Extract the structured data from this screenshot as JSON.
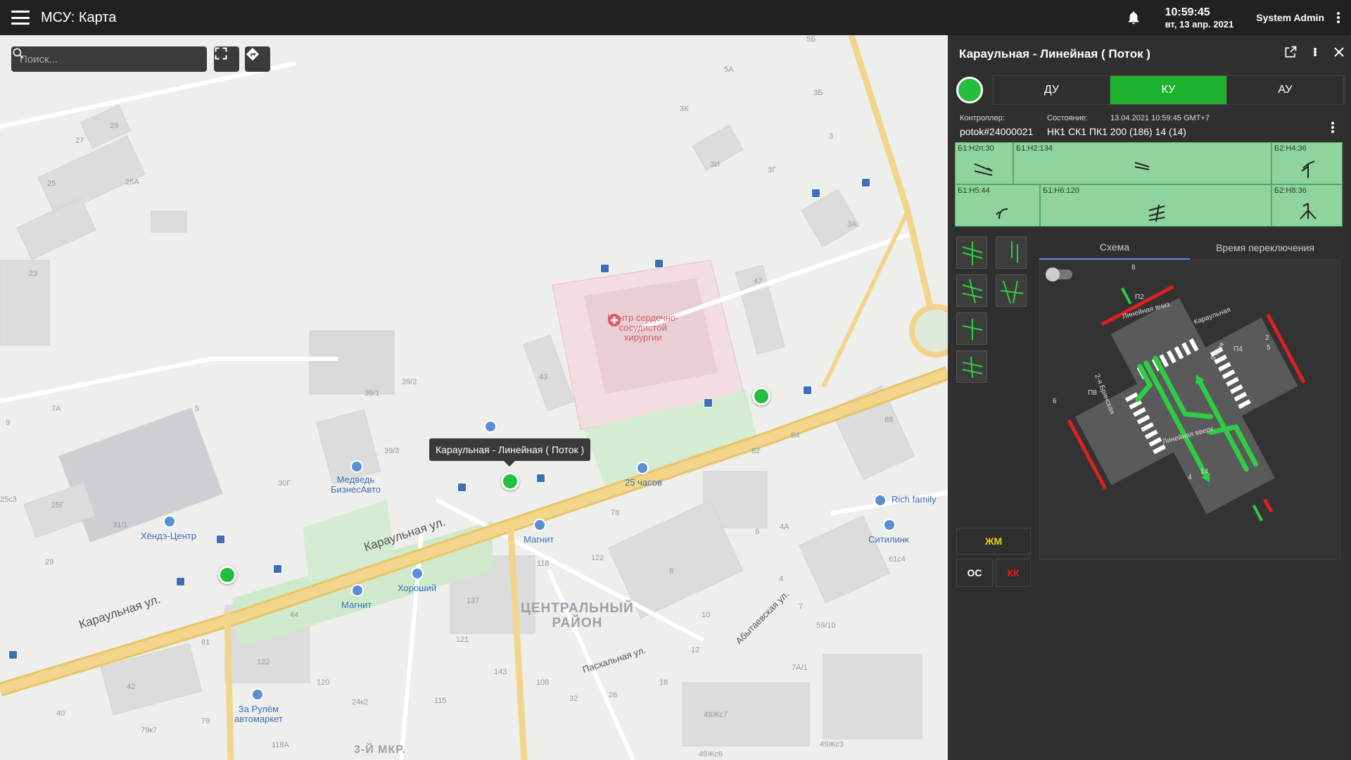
{
  "app": {
    "title": "МСУ: Карта"
  },
  "header": {
    "time": "10:59:45",
    "date": "вт, 13 апр. 2021",
    "user": "System Admin"
  },
  "map": {
    "search_placeholder": "Поиск...",
    "tooltip": "Караульная - Линейная ( Поток )",
    "district": "ЦЕНТРАЛЬНЫЙ\nРАЙОН",
    "district_line1": "ЦЕНТРАЛЬНЫЙ",
    "district_line2": "РАЙОН",
    "micro_district": "3-Й МКР.",
    "streets": {
      "karaulnaya1": "Караульная ул.",
      "karaulnaya2": "Караульная ул.",
      "pashalnaya": "Пасхальная ул.",
      "abytaevskaya": "Абытаевская ул."
    },
    "hospital": {
      "line1": "Центр сердечно-",
      "line2": "сосудистой",
      "line3": "хирургии"
    },
    "pois": {
      "medved_1": "Медведь",
      "medved_2": "БизнесАвто",
      "hendai_1": "Хёндэ-Центр",
      "magnit1": "Магнит",
      "magnit2": "Магнит",
      "horoshiy": "Хороший",
      "hours25": "25 часов",
      "zarulem_1": "За Рулём",
      "zarulem_2": "автомаркет",
      "rich": "Rich family",
      "citilink": "Ситилинк"
    },
    "house_numbers": [
      "29",
      "27",
      "25",
      "25А",
      "23",
      "7А",
      "5",
      "39/1",
      "39/2",
      "43",
      "47",
      "3А",
      "3Б",
      "3",
      "3Г",
      "3И",
      "3К",
      "5А",
      "5Б",
      "88",
      "84",
      "82",
      "78",
      "118",
      "122",
      "137",
      "121",
      "143",
      "108",
      "115",
      "32",
      "26",
      "18",
      "12",
      "10",
      "8",
      "6",
      "4",
      "4А",
      "7",
      "59/10",
      "7А/1",
      "61с4",
      "49Жс7",
      "49Жс3",
      "49Жс6",
      "118А",
      "79к7",
      "81",
      "79",
      "42",
      "40",
      "44",
      "120",
      "24к2",
      "122",
      "31/1",
      "25Г",
      "25с3",
      "29",
      "30Г",
      "39/3",
      "9"
    ]
  },
  "panel": {
    "title": "Караульная - Линейная ( Поток )",
    "modes": [
      "ДУ",
      "КУ",
      "АУ"
    ],
    "controller_label": "Контроллер:",
    "controller_value": "potok#24000021",
    "state_label": "Состояние:",
    "state_time": "13.04.2021 10:59:45 GMT+7",
    "state_value": "НК1 СК1 ПК1 200 (186) 14 (14)",
    "phases": [
      "Б1:Н2п:30",
      "Б1:Н2:134",
      "Б2:Н4:36",
      "Б1:Н5:44",
      "Б1:Н6:120",
      "Б2:Н8:36"
    ],
    "buttons": {
      "zhm": "ЖМ",
      "os": "ОС",
      "kk": "КК"
    },
    "tabs": [
      "Схема",
      "Время переключения"
    ],
    "scheme_labels": {
      "n8": "8",
      "p2": "П2",
      "n2": "2",
      "n5": "5",
      "p4": "П4",
      "n6": "6",
      "p8": "П8",
      "n4": "4",
      "n14": "14",
      "lin_down": "Линейная вниз",
      "lin_up": "Линейная вверх",
      "maya": "9 Мая",
      "brianskaya": "2-я Брянская",
      "karaulnaya": "Караульная"
    }
  },
  "colors": {
    "accent_green": "#1db32e",
    "marker_green": "#22c03c",
    "arrow_red": "#e02020",
    "road_yellow": "#f2d58a"
  },
  "icons": [
    "menu-icon",
    "bell-icon",
    "kebab-icon",
    "search-icon",
    "fullscreen-icon",
    "route-icon",
    "open-external-icon",
    "close-icon"
  ]
}
